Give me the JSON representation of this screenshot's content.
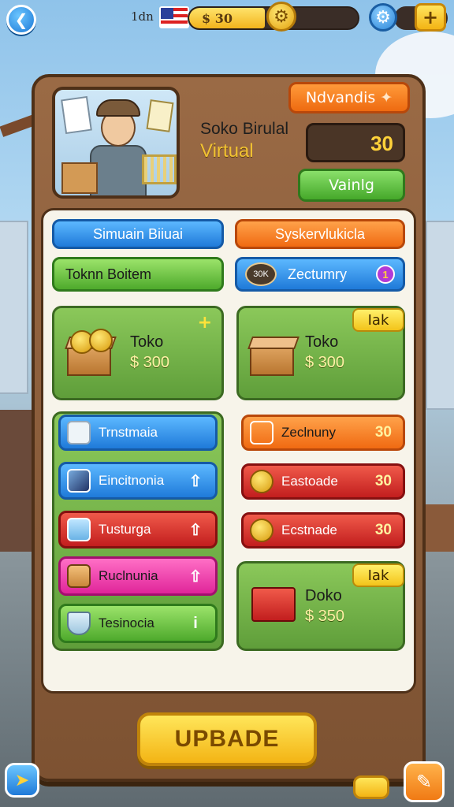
{
  "top_bar": {
    "level_label": "1dn",
    "currency_value": "$ 30",
    "currency_fill": 0.45,
    "back_icon": "arrow-left-icon",
    "gear_icon": "gear-icon",
    "settings_icon": "settings-icon",
    "plus_label": "+"
  },
  "header": {
    "title": "Soko Birulal",
    "subtitle": "Virtual",
    "tag_label": "Ndvandis",
    "tag_icon": "star-icon",
    "score": "30",
    "action_label": "Vainlg"
  },
  "tabs": {
    "top_left": "Simuain Biiuai",
    "top_right": "Syskervlukicla",
    "mid_left": "Toknn Boitem",
    "mid_right": "Zectumry",
    "mid_right_bubble": "30K",
    "mid_right_badge": "1"
  },
  "shop_cards": [
    {
      "title": "Toko",
      "price": "$ 300",
      "badge": "",
      "sparkle": "+"
    },
    {
      "title": "Toko",
      "price": "$ 300",
      "badge": "Iak"
    },
    {
      "title": "Doko",
      "price": "$ 350",
      "badge": "Iak"
    }
  ],
  "left_list": [
    {
      "label": "Trnstmaia",
      "color": "blue",
      "icon": "cup-icon",
      "arrow": ""
    },
    {
      "label": "Eincitnonia",
      "color": "blue",
      "icon": "screen-icon",
      "arrow": "⇧"
    },
    {
      "label": "Tusturga",
      "color": "red",
      "icon": "jar-icon",
      "arrow": "⇧"
    },
    {
      "label": "Ruclnunia",
      "color": "pink",
      "icon": "box-icon",
      "arrow": "⇧"
    },
    {
      "label": "Tesinocia",
      "color": "green",
      "icon": "bowl-icon",
      "arrow": "i"
    }
  ],
  "right_list": [
    {
      "label": "Zeclnuny",
      "value": "30",
      "color": "orange",
      "icon": "cube-icon"
    },
    {
      "label": "Eastoade",
      "value": "30",
      "color": "red",
      "icon": "coins-icon"
    },
    {
      "label": "Ecstnade",
      "value": "30",
      "color": "red",
      "icon": "coins-icon"
    }
  ],
  "footer": {
    "update_label": "UPBADE"
  },
  "colors": {
    "panel": "#8a5c38",
    "inner": "#f7f4ea",
    "accent_yellow": "#f3b414",
    "accent_blue": "#1f7ad9",
    "accent_green": "#4eaa2c"
  }
}
